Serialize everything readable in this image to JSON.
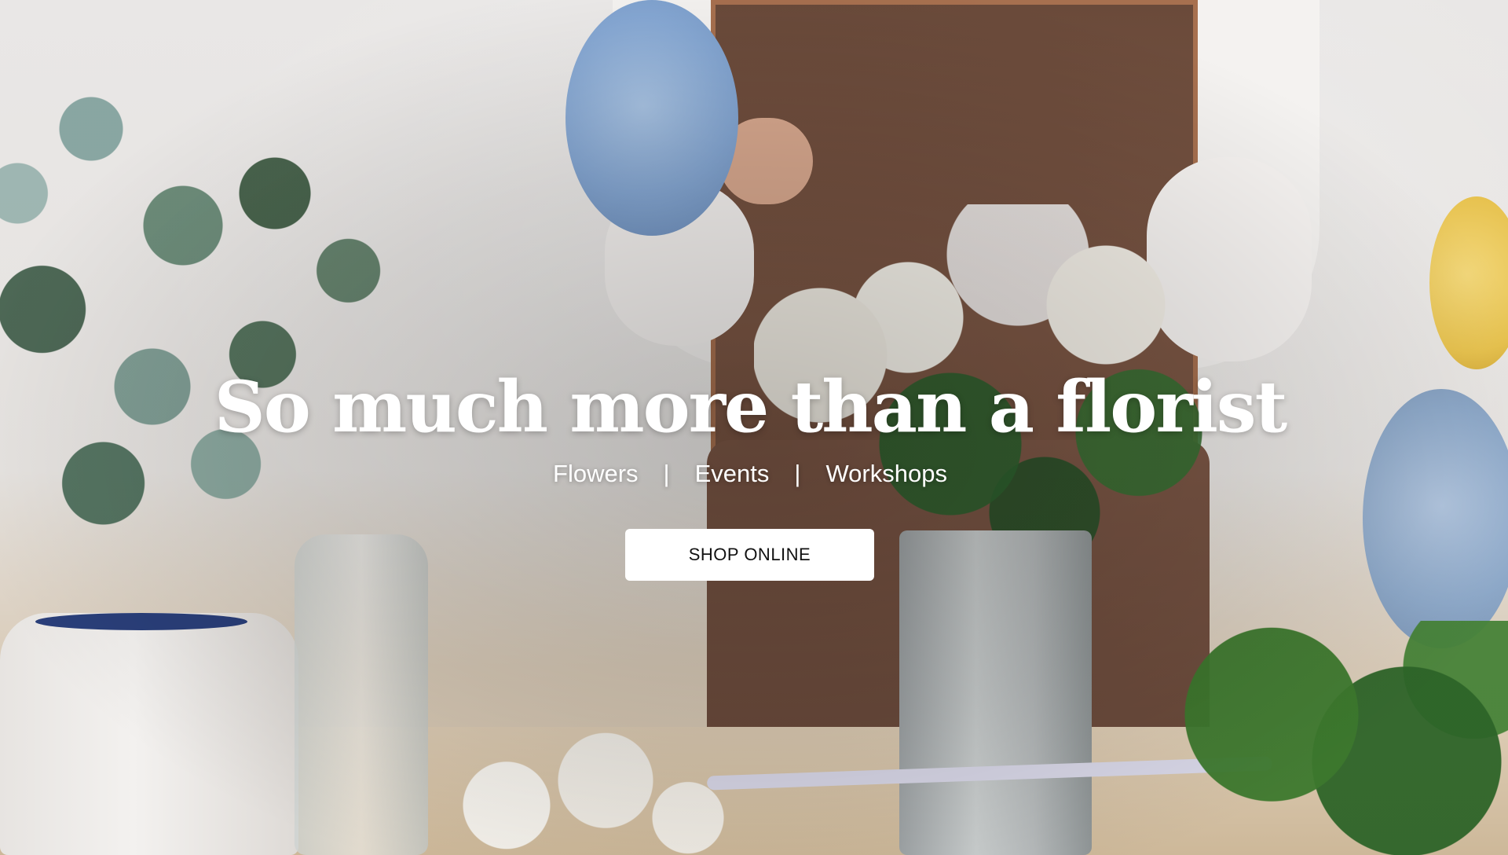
{
  "hero": {
    "headline": "So much more than a florist",
    "nav_links": [
      "Flowers",
      "Events",
      "Workshops"
    ],
    "separator": "|",
    "cta_label": "SHOP ONLINE"
  },
  "colors": {
    "headline_text": "#ffffff",
    "cta_background": "#ffffff",
    "cta_text": "#111111",
    "apron": "#6a4a3a"
  }
}
